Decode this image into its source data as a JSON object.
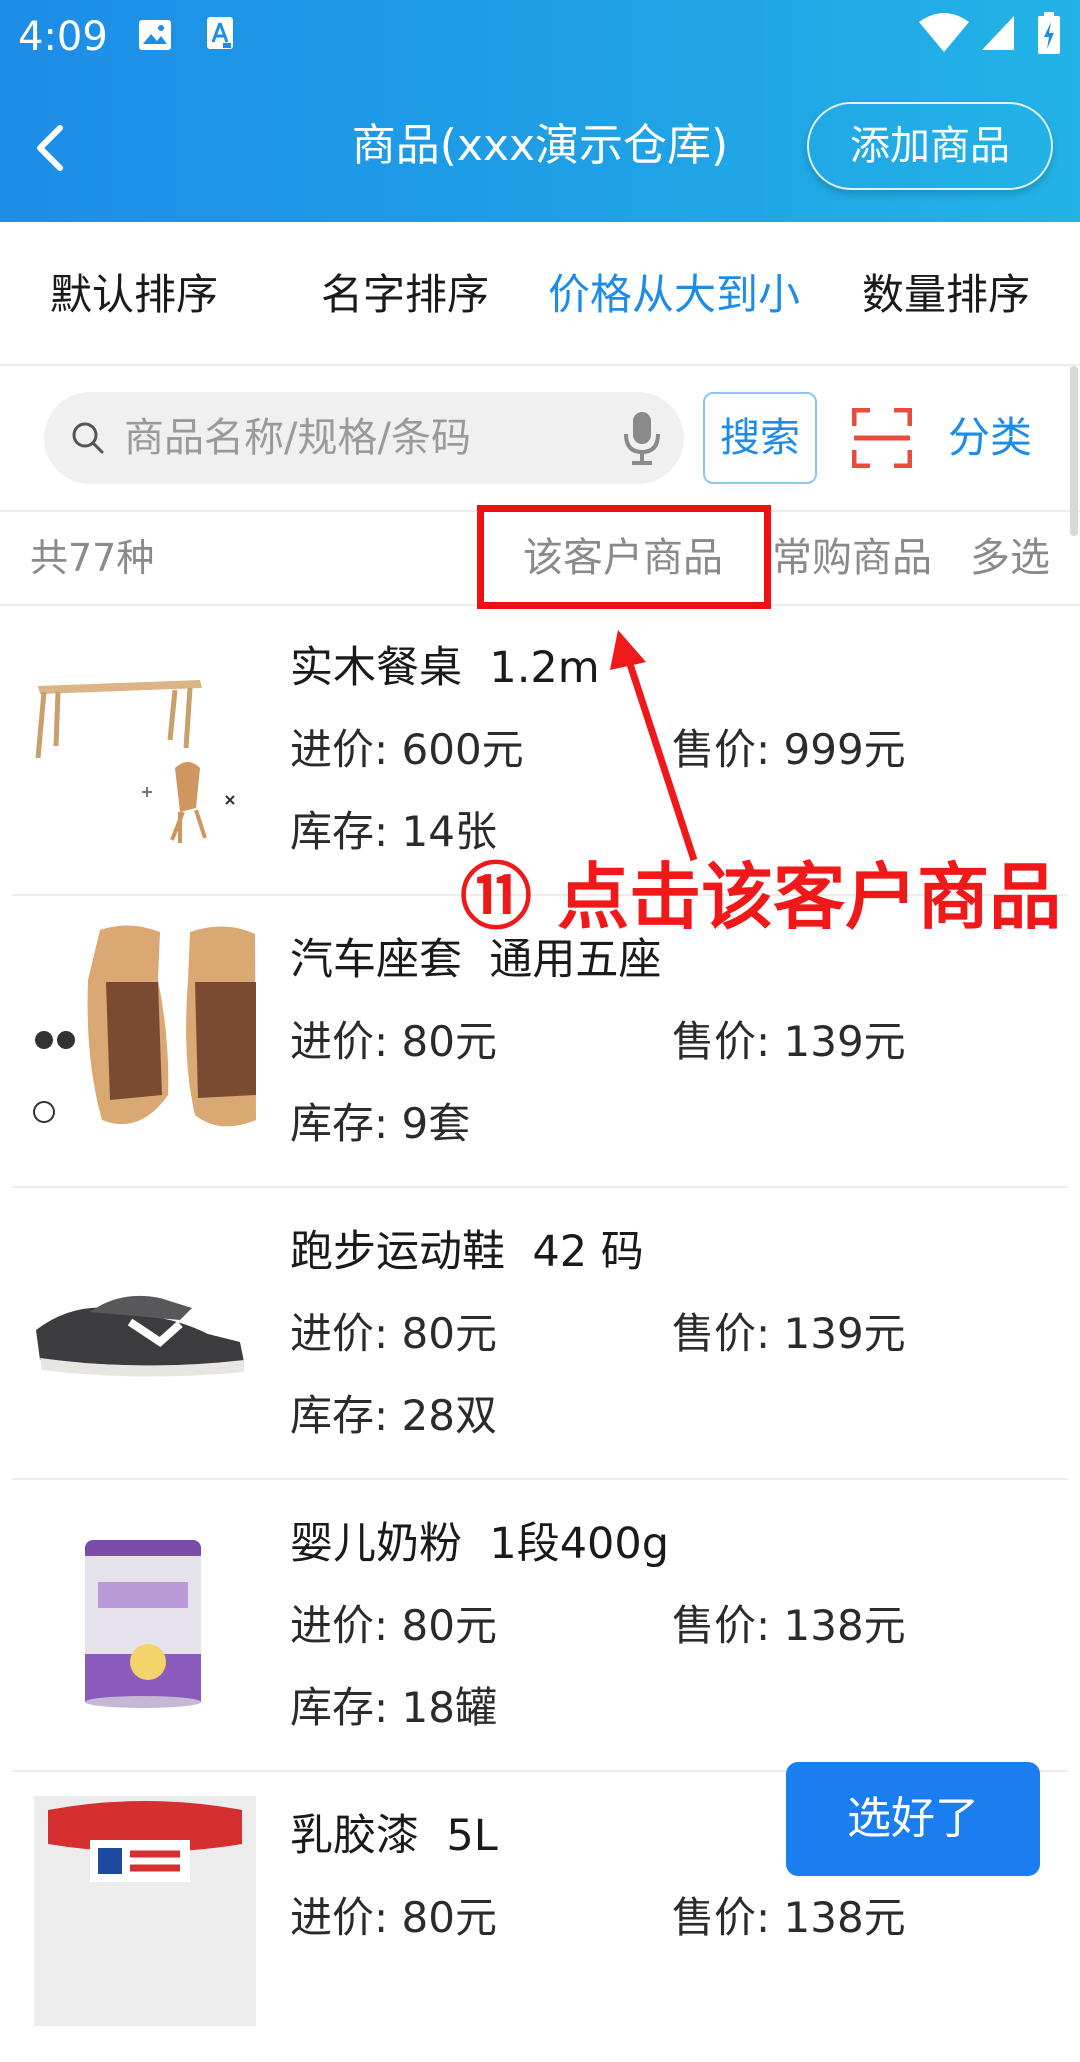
{
  "status_bar": {
    "time": "4:09"
  },
  "header": {
    "title": "商品(xxx演示仓库)",
    "add_button": "添加商品"
  },
  "sort_options": [
    {
      "label": "默认排序",
      "active": false
    },
    {
      "label": "名字排序",
      "active": false
    },
    {
      "label": "价格从大到小",
      "active": true
    },
    {
      "label": "数量排序",
      "active": false
    }
  ],
  "search": {
    "placeholder": "商品名称/规格/条码",
    "button": "搜索",
    "category": "分类"
  },
  "filter": {
    "count": "共77种",
    "customer_products": "该客户商品",
    "frequent_products": "常购商品",
    "multi_select": "多选"
  },
  "annotation": {
    "text": "⑪ 点击该客户商品"
  },
  "products": [
    {
      "name": "实木餐桌  1.2m",
      "cost": "进价: 600元",
      "price": "售价: 999元",
      "stock": "库存: 14张"
    },
    {
      "name": "汽车座套  通用五座",
      "cost": "进价: 80元",
      "price": "售价: 139元",
      "stock": "库存: 9套"
    },
    {
      "name": "跑步运动鞋  42 码",
      "cost": "进价: 80元",
      "price": "售价: 139元",
      "stock": "库存: 28双"
    },
    {
      "name": "婴儿奶粉  1段400g",
      "cost": "进价: 80元",
      "price": "售价: 138元",
      "stock": "库存: 18罐"
    },
    {
      "name": "乳胶漆  5L",
      "cost": "进价: 80元",
      "price": "售价: 138元",
      "stock": ""
    }
  ],
  "done_button": "选好了",
  "colors": {
    "header_blue": "#1d8de8",
    "accent": "#1d8ce8",
    "annotation_red": "#f01010",
    "done_blue": "#1a7ef0"
  }
}
